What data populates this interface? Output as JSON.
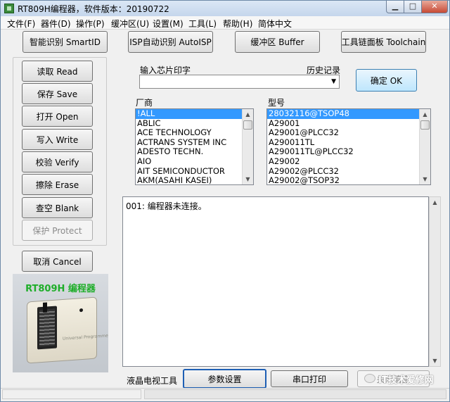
{
  "window": {
    "title": "RT809H编程器，软件版本：20190722"
  },
  "menu": [
    "文件(F)",
    "器件(D)",
    "操作(P)",
    "缓冲区(U)",
    "设置(M)",
    "工具(L)",
    "帮助(H)",
    "简体中文"
  ],
  "toolbar": {
    "smartid": "智能识别 SmartID",
    "autoisp": "ISP自动识别 AutoISP",
    "buffer": "缓冲区 Buffer",
    "toolchain": "工具链面板 Toolchain"
  },
  "ops": {
    "read": "读取 Read",
    "save": "保存 Save",
    "open": "打开 Open",
    "write": "写入 Write",
    "verify": "校验 Verify",
    "erase": "擦除 Erase",
    "blank": "查空 Blank",
    "protect": "保护 Protect",
    "cancel": "取消 Cancel"
  },
  "chip": {
    "input_label": "输入芯片印字",
    "history_label": "历史记录",
    "input_value": "",
    "ok_label": "确定 OK"
  },
  "vendor": {
    "label": "厂商",
    "items": [
      "!ALL",
      "ABLIC",
      "ACE TECHNOLOGY",
      "ACTRANS SYSTEM INC",
      "ADESTO TECHN.",
      "AIO",
      "AIT SEMICONDUCTOR",
      "AKM(ASAHI KASEI)"
    ],
    "selected_index": 0
  },
  "model": {
    "label": "型号",
    "items": [
      "28032116@TSOP48",
      "A29001",
      "A29001@PLCC32",
      "A290011TL",
      "A290011TL@PLCC32",
      "A29002",
      "A29002@PLCC32",
      "A29002@TSOP32"
    ],
    "selected_index": 0
  },
  "log": {
    "text": "001: 编程器未连接。"
  },
  "device": {
    "title": "RT809H 编程器",
    "brand": "Universal Programmer"
  },
  "bottom": {
    "tv_tool": "液晶电视工具",
    "params": "参数设置",
    "serial_print": "串口打印",
    "dismiss": "关闭清空"
  },
  "watermark": "IT技术爱修网",
  "icons": {
    "minimize": "minimize-icon",
    "maximize": "maximize-icon",
    "close": "close-icon",
    "dropdown": "chevron-down-icon"
  }
}
